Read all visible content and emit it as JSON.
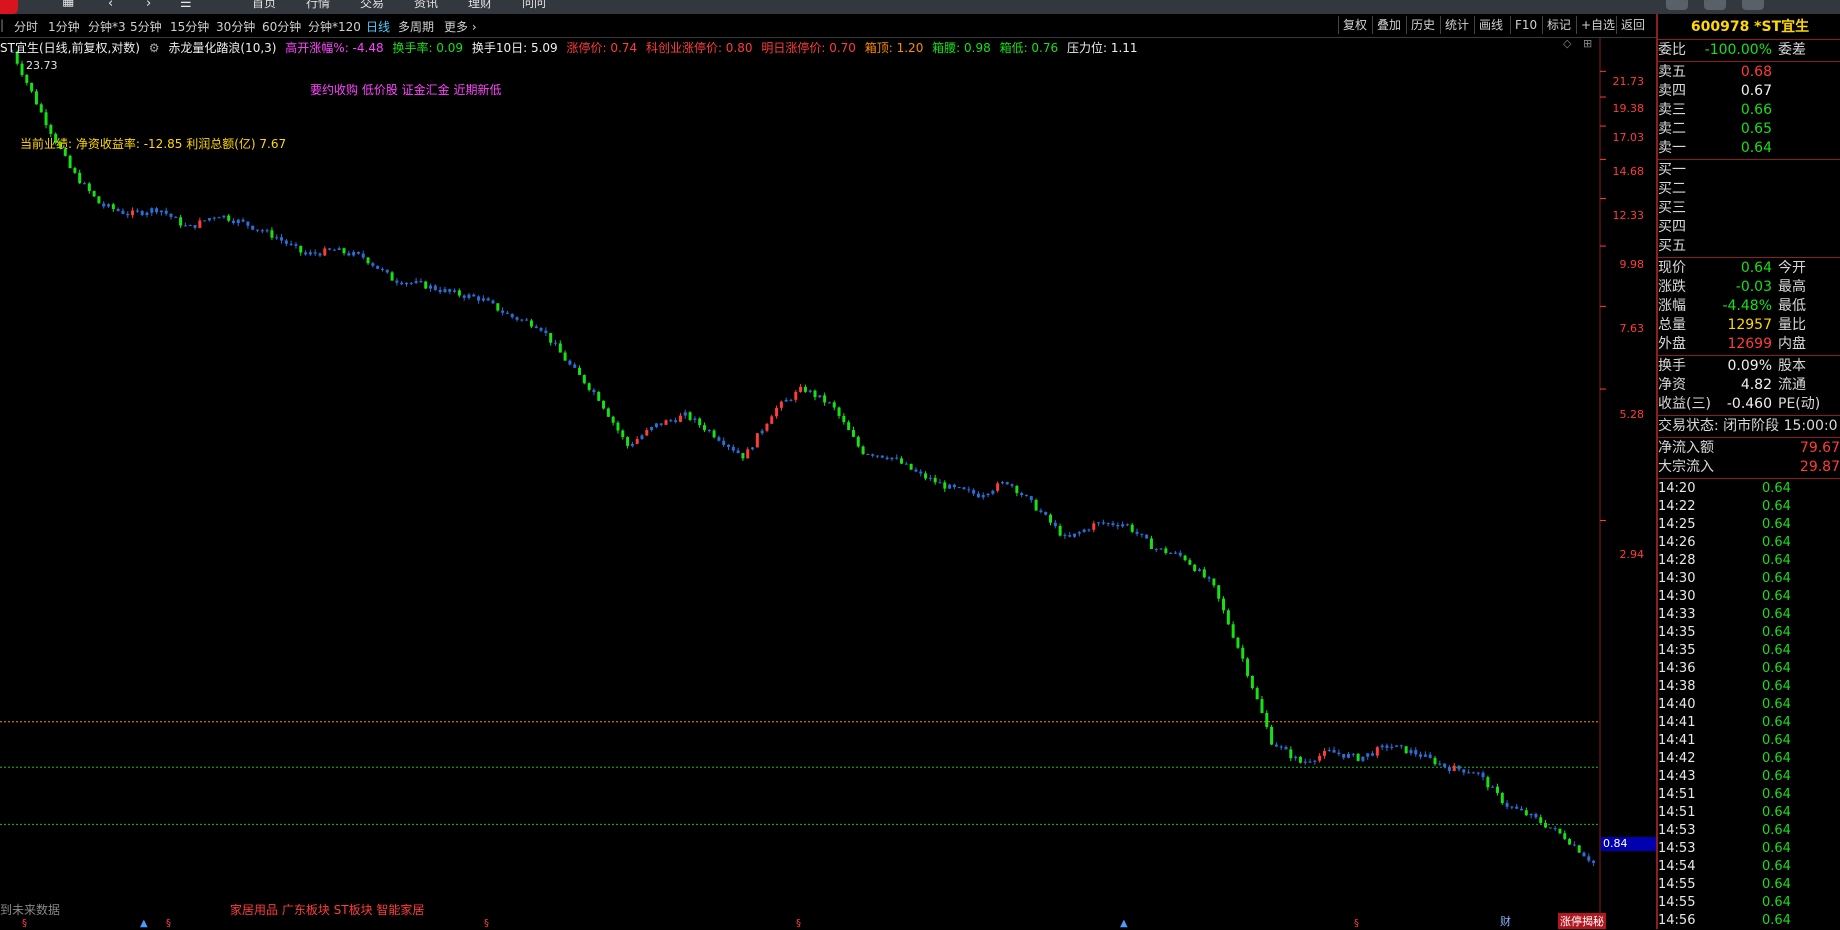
{
  "colors": {
    "up": "#ff3c3c",
    "down": "#18e018",
    "candle_flat": "#2a6fd6",
    "text_yellow": "#ffd800",
    "text_magenta": "#ff44ff",
    "orange_line": "#ff8c00",
    "green_line": "#18c018"
  },
  "topnav": {
    "items": [
      "首页",
      "行情",
      "交易",
      "资讯",
      "理财",
      "问问"
    ]
  },
  "toolbar": {
    "periods": [
      "分时",
      "1分钟",
      "分钟*3",
      "5分钟",
      "15分钟",
      "30分钟",
      "60分钟",
      "分钟*120",
      "日线",
      "多周期",
      "更多"
    ],
    "active": "日线",
    "right": [
      "复权",
      "叠加",
      "历史",
      "统计",
      "画线",
      "F10",
      "标记",
      "+自选",
      "返回"
    ]
  },
  "info": {
    "stock": "ST宜生(日线,前复权,对数)",
    "indicator": "赤龙量化踏浪(10,3)",
    "gap": "高开涨幅%: -4.48",
    "turnover": "换手率: 0.09",
    "turnover10": "换手10日: 5.09",
    "limit_up": "涨停价: 0.74",
    "kc_limit": "科创业涨停价: 0.80",
    "next_limit": "明日涨停价: 0.70",
    "box_top": "箱顶: 1.20",
    "box_waist": "箱腰: 0.98",
    "box_bottom": "箱低: 0.76",
    "pressure": "压力位: 1.11"
  },
  "chart_overlay": {
    "high_label": "23.73",
    "tags": "要约收购 低价股 证金汇金 近期新低",
    "perf": "当前业绩: 净资收益率: -12.85 利润总额(亿) 7.67",
    "future": "到未来数据",
    "sectors": "家居用品 广东板块 ST板块 智能家居",
    "current_price": "0.84",
    "bottom_tag": "涨停揭秘",
    "caijin": "财"
  },
  "chart_data": {
    "type": "candlestick",
    "y_scale": "log",
    "y_ticks": [
      21.73,
      19.38,
      17.03,
      14.68,
      12.33,
      9.98,
      7.63,
      5.28,
      2.94
    ],
    "close_path": [
      23.7,
      18,
      14,
      12,
      11.5,
      11.8,
      10.8,
      11.5,
      11,
      10.4,
      9.6,
      9.8,
      9.5,
      8.6,
      8.4,
      8.1,
      7.9,
      7.3,
      7.0,
      5.9,
      5.1,
      4.1,
      4.5,
      4.7,
      4.3,
      3.9,
      4.8,
      5.3,
      4.9,
      4.0,
      3.9,
      3.6,
      3.4,
      3.3,
      3.5,
      3.1,
      2.7,
      2.9,
      2.9,
      2.6,
      2.5,
      2.2,
      1.6,
      1.1,
      1.0,
      1.05,
      1.02,
      1.08,
      1.04,
      0.98,
      0.96,
      0.83,
      0.78,
      0.72,
      0.64
    ],
    "h_lines": {
      "orange": 1.2,
      "green_upper": 0.98,
      "green_lower": 0.76
    }
  },
  "panel": {
    "title": "600978 *ST宜生",
    "weibi_label": "委比",
    "weibi_value": "-100.00%",
    "weicha_label": "委差",
    "sell": [
      {
        "label": "卖五",
        "price": "0.68",
        "cls": "red"
      },
      {
        "label": "卖四",
        "price": "0.67",
        "cls": "white"
      },
      {
        "label": "卖三",
        "price": "0.66",
        "cls": "green"
      },
      {
        "label": "卖二",
        "price": "0.65",
        "cls": "green"
      },
      {
        "label": "卖一",
        "price": "0.64",
        "cls": "green"
      }
    ],
    "buy": [
      "买一",
      "买二",
      "买三",
      "买四",
      "买五"
    ],
    "quotes": [
      {
        "l": "现价",
        "v": "0.64",
        "c": "green",
        "r": "今开"
      },
      {
        "l": "涨跌",
        "v": "-0.03",
        "c": "green",
        "r": "最高"
      },
      {
        "l": "涨幅",
        "v": "-4.48%",
        "c": "green",
        "r": "最低"
      },
      {
        "l": "总量",
        "v": "12957",
        "c": "yellow",
        "r": "量比"
      },
      {
        "l": "外盘",
        "v": "12699",
        "c": "red",
        "r": "内盘"
      }
    ],
    "stats": [
      {
        "l": "换手",
        "v": "0.09%",
        "r": "股本"
      },
      {
        "l": "净资",
        "v": "4.82",
        "r": "流通"
      },
      {
        "l": "收益(三)",
        "v": "-0.460",
        "r": "PE(动)"
      }
    ],
    "status": "交易状态: 闭市阶段 15:00:0",
    "flow": [
      {
        "l": "净流入额",
        "v": "79.67"
      },
      {
        "l": "大宗流入",
        "v": "29.87"
      }
    ],
    "ticks": [
      {
        "t": "14:20",
        "p": "0.64"
      },
      {
        "t": "14:22",
        "p": "0.64"
      },
      {
        "t": "14:25",
        "p": "0.64"
      },
      {
        "t": "14:26",
        "p": "0.64"
      },
      {
        "t": "14:28",
        "p": "0.64"
      },
      {
        "t": "14:30",
        "p": "0.64"
      },
      {
        "t": "14:30",
        "p": "0.64"
      },
      {
        "t": "14:33",
        "p": "0.64"
      },
      {
        "t": "14:35",
        "p": "0.64"
      },
      {
        "t": "14:35",
        "p": "0.64"
      },
      {
        "t": "14:36",
        "p": "0.64"
      },
      {
        "t": "14:38",
        "p": "0.64"
      },
      {
        "t": "14:40",
        "p": "0.64"
      },
      {
        "t": "14:41",
        "p": "0.64"
      },
      {
        "t": "14:41",
        "p": "0.64"
      },
      {
        "t": "14:42",
        "p": "0.64"
      },
      {
        "t": "14:43",
        "p": "0.64"
      },
      {
        "t": "14:51",
        "p": "0.64"
      },
      {
        "t": "14:51",
        "p": "0.64"
      },
      {
        "t": "14:53",
        "p": "0.64"
      },
      {
        "t": "14:53",
        "p": "0.64"
      },
      {
        "t": "14:54",
        "p": "0.64"
      },
      {
        "t": "14:55",
        "p": "0.64"
      },
      {
        "t": "14:55",
        "p": "0.64"
      },
      {
        "t": "14:56",
        "p": "0.64"
      }
    ]
  }
}
